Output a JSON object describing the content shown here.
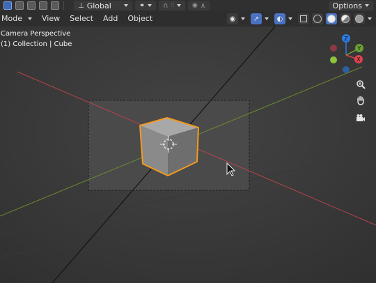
{
  "toolbar": {
    "transform_orientation": "Global",
    "options_label": "Options"
  },
  "header": {
    "mode_label": "Mode",
    "menus": [
      "View",
      "Select",
      "Add",
      "Object"
    ]
  },
  "viewport": {
    "view_name": "Camera Perspective",
    "collection_info": "(1) Collection | Cube"
  },
  "gizmo": {
    "axes": [
      {
        "label": "Z",
        "color": "#2f7be0"
      },
      {
        "label": "Y",
        "color": "#6aa033"
      },
      {
        "label": "X",
        "color": "#e0434e"
      }
    ]
  },
  "colors": {
    "x_axis": "#b8434b",
    "y_axis": "#6b8b2e",
    "selection_outline": "#f39a22",
    "active_button": "#4a72c2"
  }
}
